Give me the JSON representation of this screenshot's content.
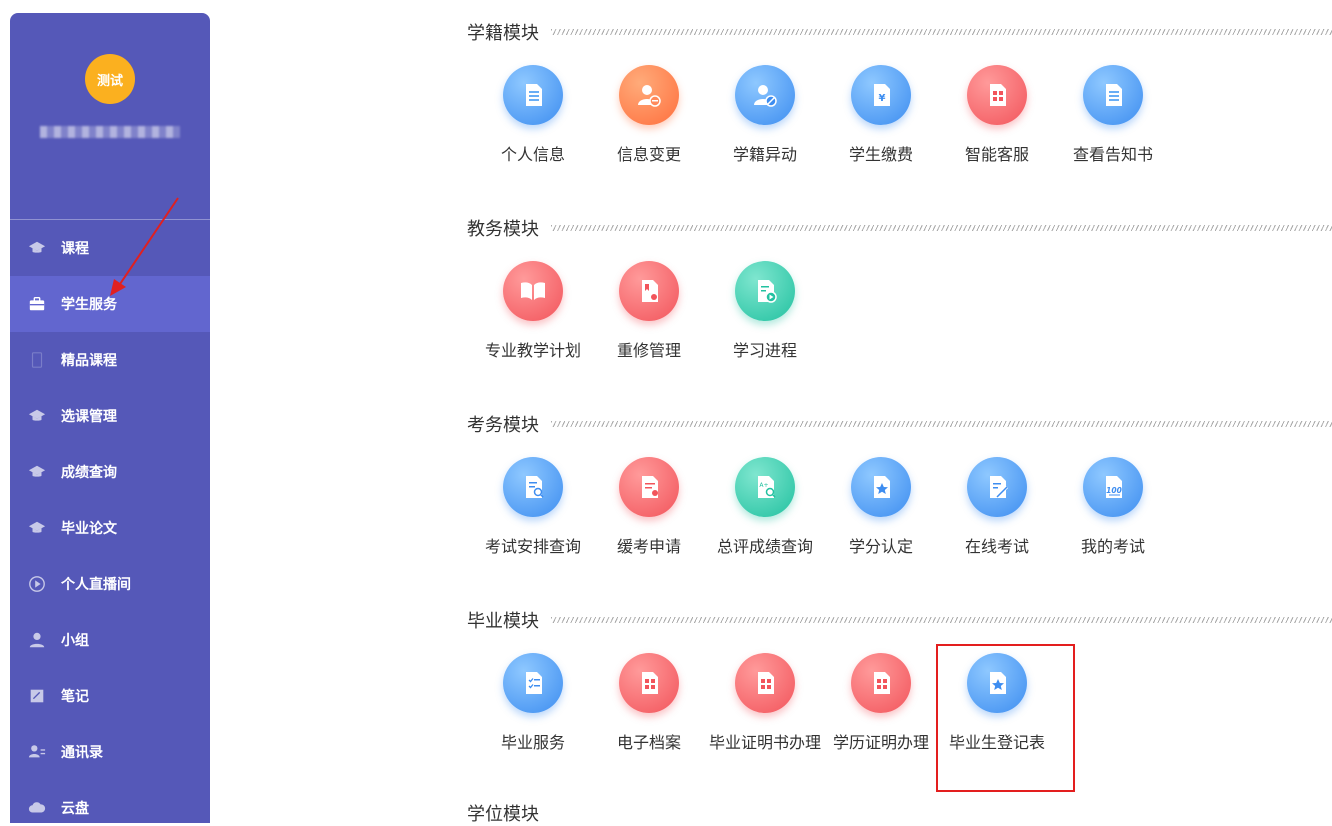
{
  "sidebar": {
    "avatar_text": "测试",
    "username": "██████████",
    "active_color": "#6266cf",
    "items": [
      {
        "label": "课程",
        "icon": "graduation-cap-icon"
      },
      {
        "label": "学生服务",
        "icon": "briefcase-icon",
        "active": true
      },
      {
        "label": "精品课程",
        "icon": "book-icon"
      },
      {
        "label": "选课管理",
        "icon": "graduation-cap-icon"
      },
      {
        "label": "成绩查询",
        "icon": "graduation-cap-icon"
      },
      {
        "label": "毕业论文",
        "icon": "graduation-cap-icon"
      },
      {
        "label": "个人直播间",
        "icon": "play-circle-icon"
      },
      {
        "label": "小组",
        "icon": "user-icon"
      },
      {
        "label": "笔记",
        "icon": "note-icon"
      },
      {
        "label": "通讯录",
        "icon": "contacts-icon"
      },
      {
        "label": "云盘",
        "icon": "cloud-icon"
      }
    ]
  },
  "sections": [
    {
      "title": "学籍模块",
      "tiles": [
        {
          "label": "个人信息",
          "color": "blue",
          "icon": "document-list-icon"
        },
        {
          "label": "信息变更",
          "color": "orange",
          "icon": "user-edit-icon"
        },
        {
          "label": "学籍异动",
          "color": "blue",
          "icon": "user-prohibit-icon"
        },
        {
          "label": "学生缴费",
          "color": "blue",
          "icon": "yuan-document-icon"
        },
        {
          "label": "智能客服",
          "color": "red",
          "icon": "grid-document-icon"
        },
        {
          "label": "查看告知书",
          "color": "blue",
          "icon": "document-list-icon"
        }
      ]
    },
    {
      "title": "教务模块",
      "tiles": [
        {
          "label": "专业教学计划",
          "color": "red",
          "icon": "open-book-icon"
        },
        {
          "label": "重修管理",
          "color": "red",
          "icon": "bookmark-document-icon"
        },
        {
          "label": "学习进程",
          "color": "green",
          "icon": "video-document-icon"
        }
      ]
    },
    {
      "title": "考务模块",
      "tiles": [
        {
          "label": "考试安排查询",
          "color": "blue",
          "icon": "search-document-icon"
        },
        {
          "label": "缓考申请",
          "color": "red",
          "icon": "clipboard-icon"
        },
        {
          "label": "总评成绩查询",
          "color": "green",
          "icon": "grade-search-icon"
        },
        {
          "label": "学分认定",
          "color": "blue",
          "icon": "star-document-icon"
        },
        {
          "label": "在线考试",
          "color": "blue",
          "icon": "pen-document-icon"
        },
        {
          "label": "我的考试",
          "color": "blue",
          "icon": "score-100-icon"
        }
      ]
    },
    {
      "title": "毕业模块",
      "tiles": [
        {
          "label": "毕业服务",
          "color": "blue",
          "icon": "checklist-icon"
        },
        {
          "label": "电子档案",
          "color": "red",
          "icon": "grid-document-icon"
        },
        {
          "label": "毕业证明书办理",
          "color": "red",
          "icon": "grid-document-icon"
        },
        {
          "label": "学历证明办理",
          "color": "red",
          "icon": "grid-document-icon"
        },
        {
          "label": "毕业生登记表",
          "color": "blue",
          "icon": "star-document-icon"
        }
      ]
    }
  ],
  "next_section_title": "学位模块"
}
